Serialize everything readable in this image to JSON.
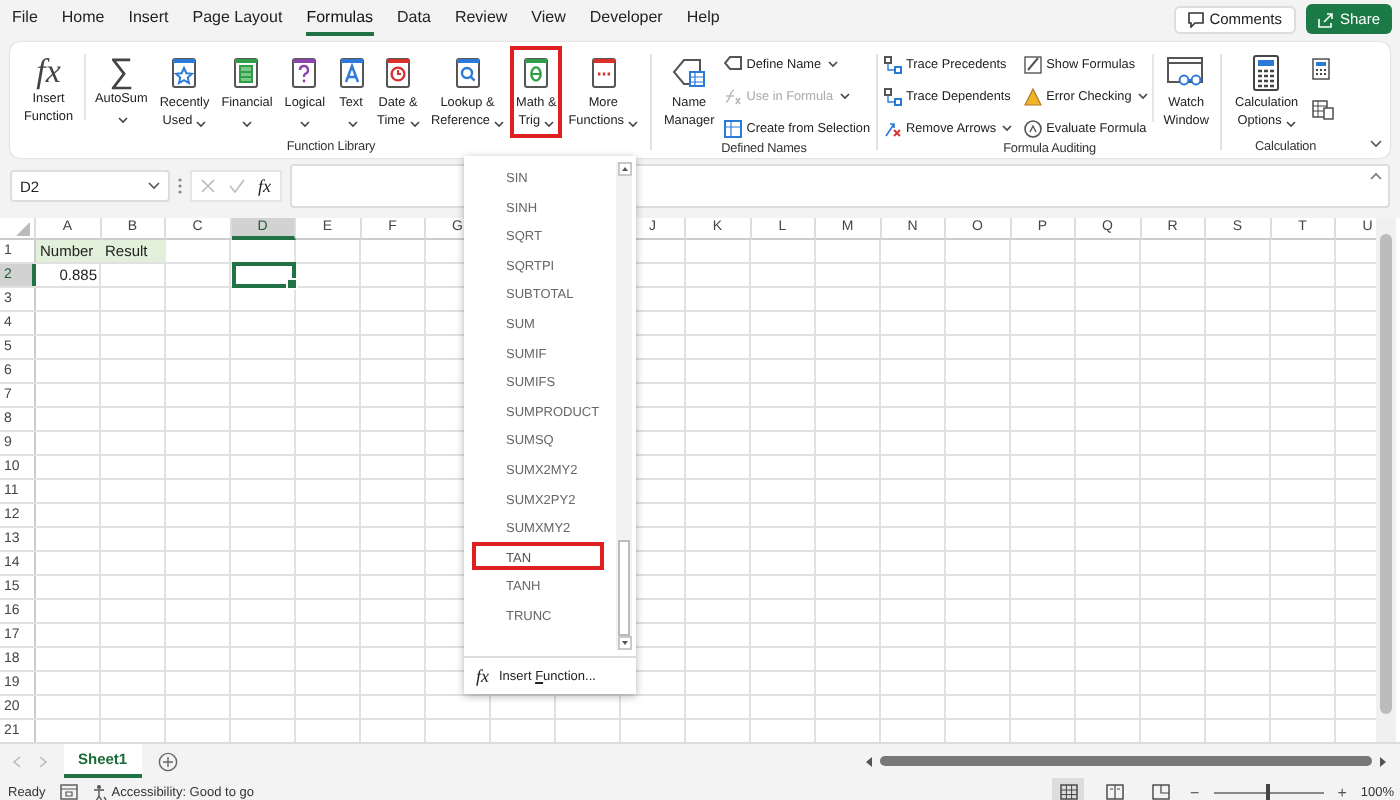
{
  "menu_tabs": [
    {
      "label": "File",
      "selected": false
    },
    {
      "label": "Home",
      "selected": false
    },
    {
      "label": "Insert",
      "selected": false
    },
    {
      "label": "Page Layout",
      "selected": false
    },
    {
      "label": "Formulas",
      "selected": true
    },
    {
      "label": "Data",
      "selected": false
    },
    {
      "label": "Review",
      "selected": false
    },
    {
      "label": "View",
      "selected": false
    },
    {
      "label": "Developer",
      "selected": false
    },
    {
      "label": "Help",
      "selected": false
    }
  ],
  "comments_button": "Comments",
  "share_button": "Share",
  "ribbon": {
    "function_library": {
      "label": "Function Library",
      "buttons": [
        {
          "lines": [
            "Insert",
            "Function"
          ],
          "symbol": "fx",
          "dropdown": false,
          "selected": false
        },
        {
          "lines": [
            "AutoSum"
          ],
          "symbol": "∑",
          "dropdown": true,
          "selected": false
        },
        {
          "lines": [
            "Recently",
            "Used"
          ],
          "dropdown": true,
          "selected": false
        },
        {
          "lines": [
            "Financial"
          ],
          "dropdown": true,
          "selected": false
        },
        {
          "lines": [
            "Logical"
          ],
          "dropdown": true,
          "selected": false
        },
        {
          "lines": [
            "Text"
          ],
          "dropdown": true,
          "selected": false
        },
        {
          "lines": [
            "Date &",
            "Time"
          ],
          "dropdown": true,
          "selected": false
        },
        {
          "lines": [
            "Lookup &",
            "Reference"
          ],
          "dropdown": true,
          "selected": false
        },
        {
          "lines": [
            "Math &",
            "Trig"
          ],
          "dropdown": true,
          "selected": true
        },
        {
          "lines": [
            "More",
            "Functions"
          ],
          "dropdown": true,
          "selected": false
        }
      ]
    },
    "defined_names": {
      "label": "Defined Names",
      "manager": [
        "Name",
        "Manager"
      ],
      "buttons": [
        {
          "label": "Define Name",
          "dropdown": true,
          "disabled": false
        },
        {
          "label": "Use in Formula",
          "dropdown": true,
          "disabled": true
        },
        {
          "label": "Create from Selection",
          "dropdown": false,
          "disabled": false
        }
      ]
    },
    "formula_auditing": {
      "label": "Formula Auditing",
      "buttons": [
        {
          "label": "Trace Precedents",
          "dropdown": false
        },
        {
          "label": "Trace Dependents",
          "dropdown": false
        },
        {
          "label": "Remove Arrows",
          "dropdown": true
        },
        {
          "label": "Show Formulas",
          "dropdown": false
        },
        {
          "label": "Error Checking",
          "dropdown": true
        },
        {
          "label": "Evaluate Formula",
          "dropdown": false
        }
      ],
      "watch": [
        "Watch",
        "Window"
      ]
    },
    "calculation": {
      "label": "Calculation",
      "options": [
        "Calculation",
        "Options"
      ]
    }
  },
  "formula_bar": {
    "name_box": "D2",
    "fx": "fx"
  },
  "grid": {
    "columns": [
      {
        "label": "A",
        "selected": false
      },
      {
        "label": "B",
        "selected": false
      },
      {
        "label": "C",
        "selected": false
      },
      {
        "label": "D",
        "selected": true
      },
      {
        "label": "E",
        "selected": false
      },
      {
        "label": "F",
        "selected": false
      },
      {
        "label": "G",
        "selected": false
      },
      {},
      {},
      {
        "label": "J",
        "selected": false
      },
      {
        "label": "K",
        "selected": false
      },
      {
        "label": "L",
        "selected": false
      },
      {
        "label": "M",
        "selected": false
      },
      {
        "label": "N",
        "selected": false
      },
      {
        "label": "O",
        "selected": false
      },
      {
        "label": "P",
        "selected": false
      },
      {
        "label": "Q",
        "selected": false
      },
      {
        "label": "R",
        "selected": false
      },
      {
        "label": "S",
        "selected": false
      },
      {
        "label": "T",
        "selected": false
      },
      {
        "label": "U",
        "selected": false
      }
    ],
    "rows": [
      {
        "label": "1",
        "selected": false,
        "cells": [
          {
            "text": "Number",
            "kind": "header"
          },
          {
            "text": "Result",
            "kind": "header"
          }
        ]
      },
      {
        "label": "2",
        "selected": true,
        "cells": [
          {
            "text": "0.885",
            "kind": "number"
          }
        ]
      },
      {
        "label": "3",
        "selected": false
      },
      {
        "label": "4",
        "selected": false
      },
      {
        "label": "5",
        "selected": false
      },
      {
        "label": "6",
        "selected": false
      },
      {
        "label": "7",
        "selected": false
      },
      {
        "label": "8",
        "selected": false
      },
      {
        "label": "9",
        "selected": false
      },
      {
        "label": "10",
        "selected": false
      },
      {
        "label": "11",
        "selected": false
      },
      {
        "label": "12",
        "selected": false
      },
      {
        "label": "13",
        "selected": false
      },
      {
        "label": "14",
        "selected": false
      },
      {
        "label": "15",
        "selected": false
      },
      {
        "label": "16",
        "selected": false
      },
      {
        "label": "17",
        "selected": false
      },
      {
        "label": "18",
        "selected": false
      },
      {
        "label": "19",
        "selected": false
      },
      {
        "label": "20",
        "selected": false
      },
      {
        "label": "21",
        "selected": false
      }
    ]
  },
  "dropdown": {
    "items": [
      {
        "label": "SIN",
        "selected": false
      },
      {
        "label": "SINH",
        "selected": false
      },
      {
        "label": "SQRT",
        "selected": false
      },
      {
        "label": "SQRTPI",
        "selected": false
      },
      {
        "label": "SUBTOTAL",
        "selected": false
      },
      {
        "label": "SUM",
        "selected": false
      },
      {
        "label": "SUMIF",
        "selected": false
      },
      {
        "label": "SUMIFS",
        "selected": false
      },
      {
        "label": "SUMPRODUCT",
        "selected": false
      },
      {
        "label": "SUMSQ",
        "selected": false
      },
      {
        "label": "SUMX2MY2",
        "selected": false
      },
      {
        "label": "SUMX2PY2",
        "selected": false
      },
      {
        "label": "SUMXMY2",
        "selected": false
      },
      {
        "label": "TAN",
        "selected": true
      },
      {
        "label": "TANH",
        "selected": false
      },
      {
        "label": "TRUNC",
        "selected": false
      }
    ],
    "footer": {
      "symbol": "fx",
      "label": "Insert ",
      "accel": "F",
      "rest": "unction..."
    }
  },
  "sheet_tabs": [
    {
      "label": "Sheet1",
      "selected": true
    }
  ],
  "status_bar": {
    "ready": "Ready",
    "accessibility": "Accessibility: Good to go",
    "zoom_minus": "−",
    "zoom_plus": "+",
    "zoom_slider": {
      "level": 0.5
    },
    "zoom": "100%"
  }
}
